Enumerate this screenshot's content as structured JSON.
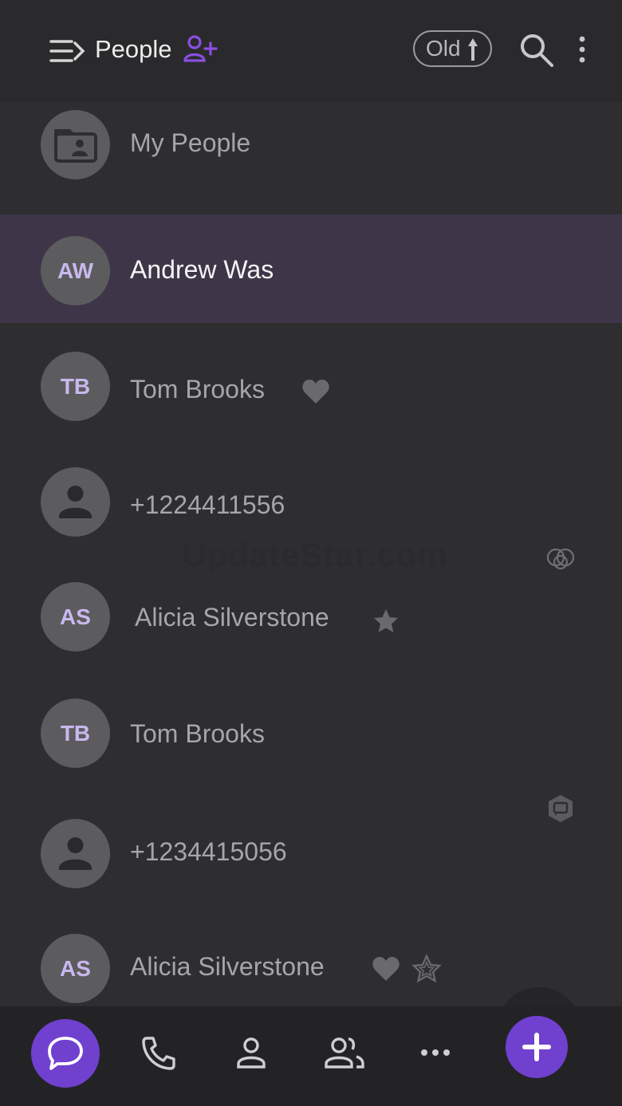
{
  "header": {
    "title": "People",
    "sort_label": "Old"
  },
  "colors": {
    "accent": "#7040cf",
    "avatar_initials": "#c9b8ee",
    "selected_row": "#3e3648",
    "background": "#2e2e30"
  },
  "group": {
    "label": "My People",
    "icon": "folder-person-icon"
  },
  "contacts": [
    {
      "initials": "AW",
      "name": "Andrew Was",
      "selected": true
    },
    {
      "initials": "TB",
      "name": "Tom Brooks",
      "badges": [
        "heart-icon"
      ]
    },
    {
      "initials": "",
      "name": "+1224411556",
      "avatar_icon": "person-icon",
      "badges": [
        "circles-icon"
      ]
    },
    {
      "initials": "AS",
      "name": "Alicia Silverstone",
      "badges": [
        "star-icon"
      ]
    },
    {
      "initials": "TB",
      "name": "Tom Brooks"
    },
    {
      "initials": "",
      "name": "+1234415056",
      "avatar_icon": "person-icon",
      "badges": [
        "chat-badge-icon"
      ]
    },
    {
      "initials": "AS",
      "name": "Alicia Silverstone",
      "badges": [
        "heart-icon",
        "star-outline-icon"
      ]
    }
  ],
  "watermark": "UpdateStar.com",
  "bottom_nav": [
    "chat-icon",
    "phone-icon",
    "person-icon",
    "group-icon",
    "more-horizontal-icon"
  ],
  "fab": "plus-icon"
}
